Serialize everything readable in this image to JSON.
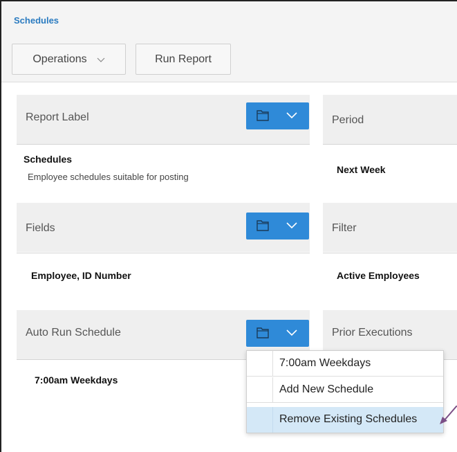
{
  "header": {
    "title": "Schedules"
  },
  "toolbar": {
    "operations_label": "Operations",
    "run_report_label": "Run Report"
  },
  "panels": {
    "report_label": {
      "label": "Report Label",
      "value": "Schedules",
      "description": "Employee schedules suitable for posting"
    },
    "period": {
      "label": "Period",
      "value": "Next Week"
    },
    "fields": {
      "label": "Fields",
      "value": "Employee, ID Number"
    },
    "filter": {
      "label": "Filter",
      "value": "Active Employees"
    },
    "auto_run": {
      "label": "Auto Run Schedule",
      "value": "7:00am Weekdays"
    },
    "prior_executions": {
      "label": "Prior Executions"
    }
  },
  "dropdown": {
    "items": [
      {
        "label": "7:00am Weekdays"
      },
      {
        "label": "Add New Schedule"
      },
      {
        "label": "Remove Existing Schedules"
      }
    ]
  },
  "colors": {
    "accent": "#2f8ad8",
    "title": "#2a7bc0",
    "highlight": "#d4e8f7",
    "arrow": "#7b4f86"
  },
  "icons": {
    "folder": "folder-icon",
    "chevron": "chevron-down-icon",
    "pointer": "pointer-arrow-icon"
  }
}
